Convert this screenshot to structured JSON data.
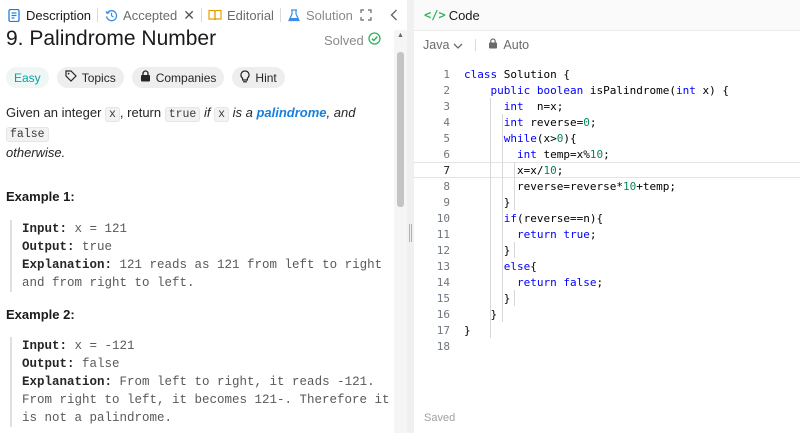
{
  "tabs": [
    {
      "label": "Description",
      "icon": "description-icon",
      "active": true
    },
    {
      "label": "Accepted",
      "icon": "history-icon",
      "closable": true
    },
    {
      "label": "Editorial",
      "icon": "book-icon"
    },
    {
      "label": "Solution",
      "icon": "flask-icon"
    }
  ],
  "problem": {
    "title": "9. Palindrome Number",
    "status": "Solved",
    "tags": [
      "Easy",
      "Topics",
      "Companies",
      "Hint"
    ],
    "description": {
      "part1": "Given an integer ",
      "code_x": "x",
      "part2": ", return ",
      "code_true": "true",
      "part3": " if ",
      "code_x2": "x",
      "part4": " is a ",
      "link": "palindrome",
      "part5": ", and ",
      "code_false": "false",
      "part6": "otherwise."
    },
    "examples": [
      {
        "title": "Example 1:",
        "input_label": "Input:",
        "input": "x = 121",
        "output_label": "Output:",
        "output": "true",
        "explanation_label": "Explanation:",
        "explanation": "121 reads as 121 from left to right and from right to left."
      },
      {
        "title": "Example 2:",
        "input_label": "Input:",
        "input": "x = -121",
        "output_label": "Output:",
        "output": "false",
        "explanation_label": "Explanation:",
        "explanation": "From left to right, it reads -121. From right to left, it becomes 121-. Therefore it is not a palindrome."
      }
    ]
  },
  "code_panel": {
    "title": "Code",
    "language": "Java",
    "mode": "Auto",
    "status": "Saved",
    "current_line": 7
  },
  "code_lines": [
    "class Solution {",
    "    public boolean isPalindrome(int x) {",
    "      int  n=x;",
    "      int reverse=0;",
    "      while(x>0){",
    "        int temp=x%10;",
    "        x=x/10;",
    "        reverse=reverse*10+temp;",
    "      }",
    "      if(reverse==n){",
    "        return true;",
    "      }",
    "      else{",
    "        return false;",
    "      }",
    "    }",
    "}",
    ""
  ],
  "colors": {
    "accent_green": "#2db55d",
    "easy_teal": "#00a5a3",
    "link_blue": "#1a7fe0",
    "keyword_blue": "#0000ff"
  }
}
